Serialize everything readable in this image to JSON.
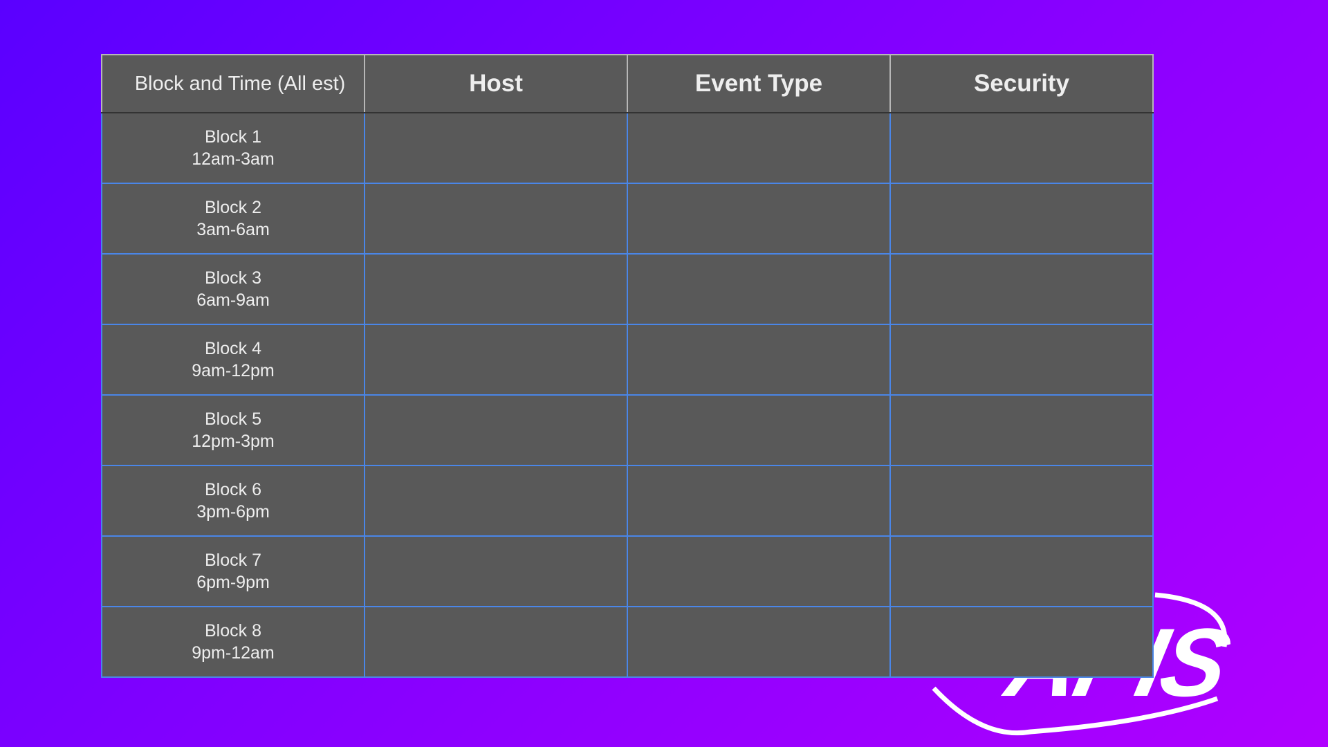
{
  "table": {
    "headers": {
      "block_time": "Block and Time (All est)",
      "host": "Host",
      "event_type": "Event Type",
      "security": "Security"
    },
    "rows": [
      {
        "block": "Block 1",
        "time": "12am-3am",
        "host": "",
        "event_type": "",
        "security": ""
      },
      {
        "block": "Block 2",
        "time": "3am-6am",
        "host": "",
        "event_type": "",
        "security": ""
      },
      {
        "block": "Block 3",
        "time": "6am-9am",
        "host": "",
        "event_type": "",
        "security": ""
      },
      {
        "block": "Block 4",
        "time": "9am-12pm",
        "host": "",
        "event_type": "",
        "security": ""
      },
      {
        "block": "Block 5",
        "time": "12pm-3pm",
        "host": "",
        "event_type": "",
        "security": ""
      },
      {
        "block": "Block 6",
        "time": "3pm-6pm",
        "host": "",
        "event_type": "",
        "security": ""
      },
      {
        "block": "Block 7",
        "time": "6pm-9pm",
        "host": "",
        "event_type": "",
        "security": ""
      },
      {
        "block": "Block 8",
        "time": "9pm-12am",
        "host": "",
        "event_type": "",
        "security": ""
      }
    ]
  },
  "logo": {
    "text": "APIS"
  },
  "colors": {
    "background_start": "#5a00ff",
    "background_end": "#b000ff",
    "table_fill": "#595959",
    "grid_lines": "#4a86e8",
    "text": "#eeeeee"
  }
}
